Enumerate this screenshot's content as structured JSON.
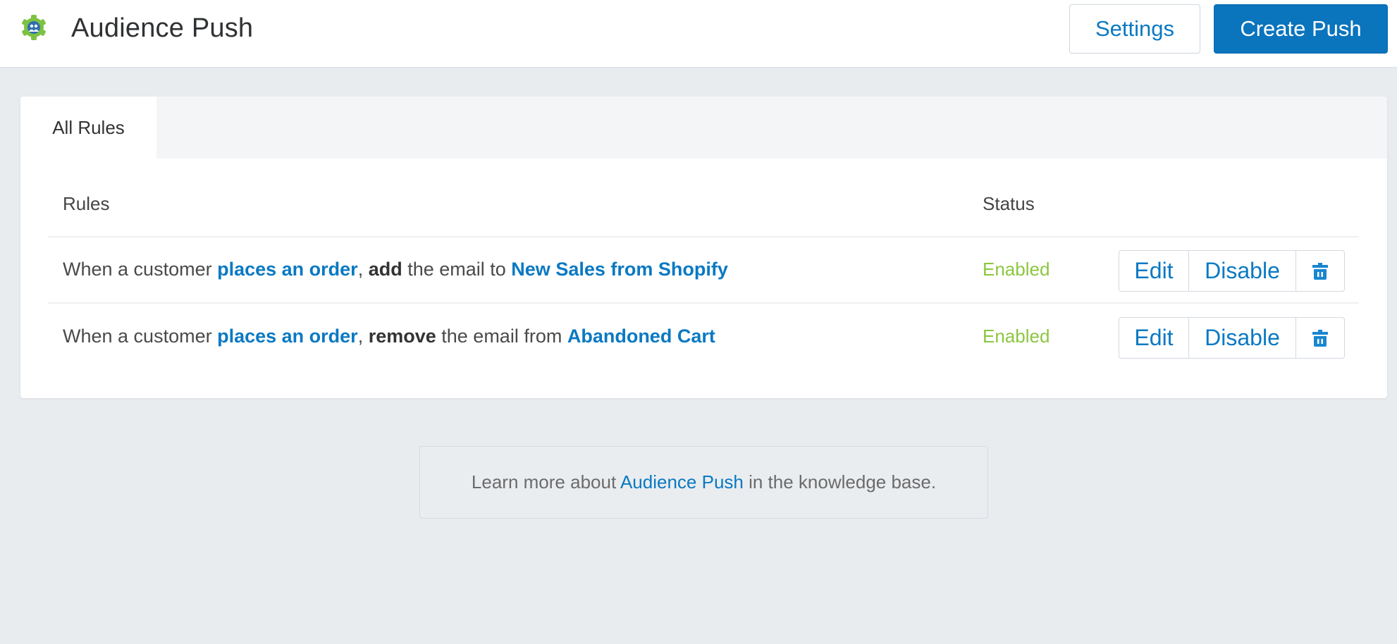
{
  "header": {
    "logo_icon": "green-gear-audience-logo",
    "title": "Audience Push",
    "settings_label": "Settings",
    "create_label": "Create Push"
  },
  "tabs": [
    {
      "label": "All Rules",
      "active": true
    }
  ],
  "table": {
    "columns": [
      "Rules",
      "Status"
    ],
    "rows": [
      {
        "prefix": "When a customer ",
        "trigger": "places an order",
        "comma": ", ",
        "action": "add",
        "middle": " the email to ",
        "target": "New Sales from Shopify",
        "status": "Enabled",
        "edit_label": "Edit",
        "disable_label": "Disable",
        "delete_icon": "trash-icon"
      },
      {
        "prefix": "When a customer ",
        "trigger": "places an order",
        "comma": ", ",
        "action": "remove",
        "middle": " the email from ",
        "target": "Abandoned Cart",
        "status": "Enabled",
        "edit_label": "Edit",
        "disable_label": "Disable",
        "delete_icon": "trash-icon"
      }
    ]
  },
  "footer": {
    "prefix": "Learn more about ",
    "link": "Audience Push",
    "suffix": " in the knowledge base."
  },
  "colors": {
    "primary": "#0a74bd",
    "link": "#0a79c2",
    "enabled": "#8cc63f",
    "logo_green": "#7dc242",
    "logo_blue": "#2f6fb0",
    "background": "#e9ecef"
  }
}
